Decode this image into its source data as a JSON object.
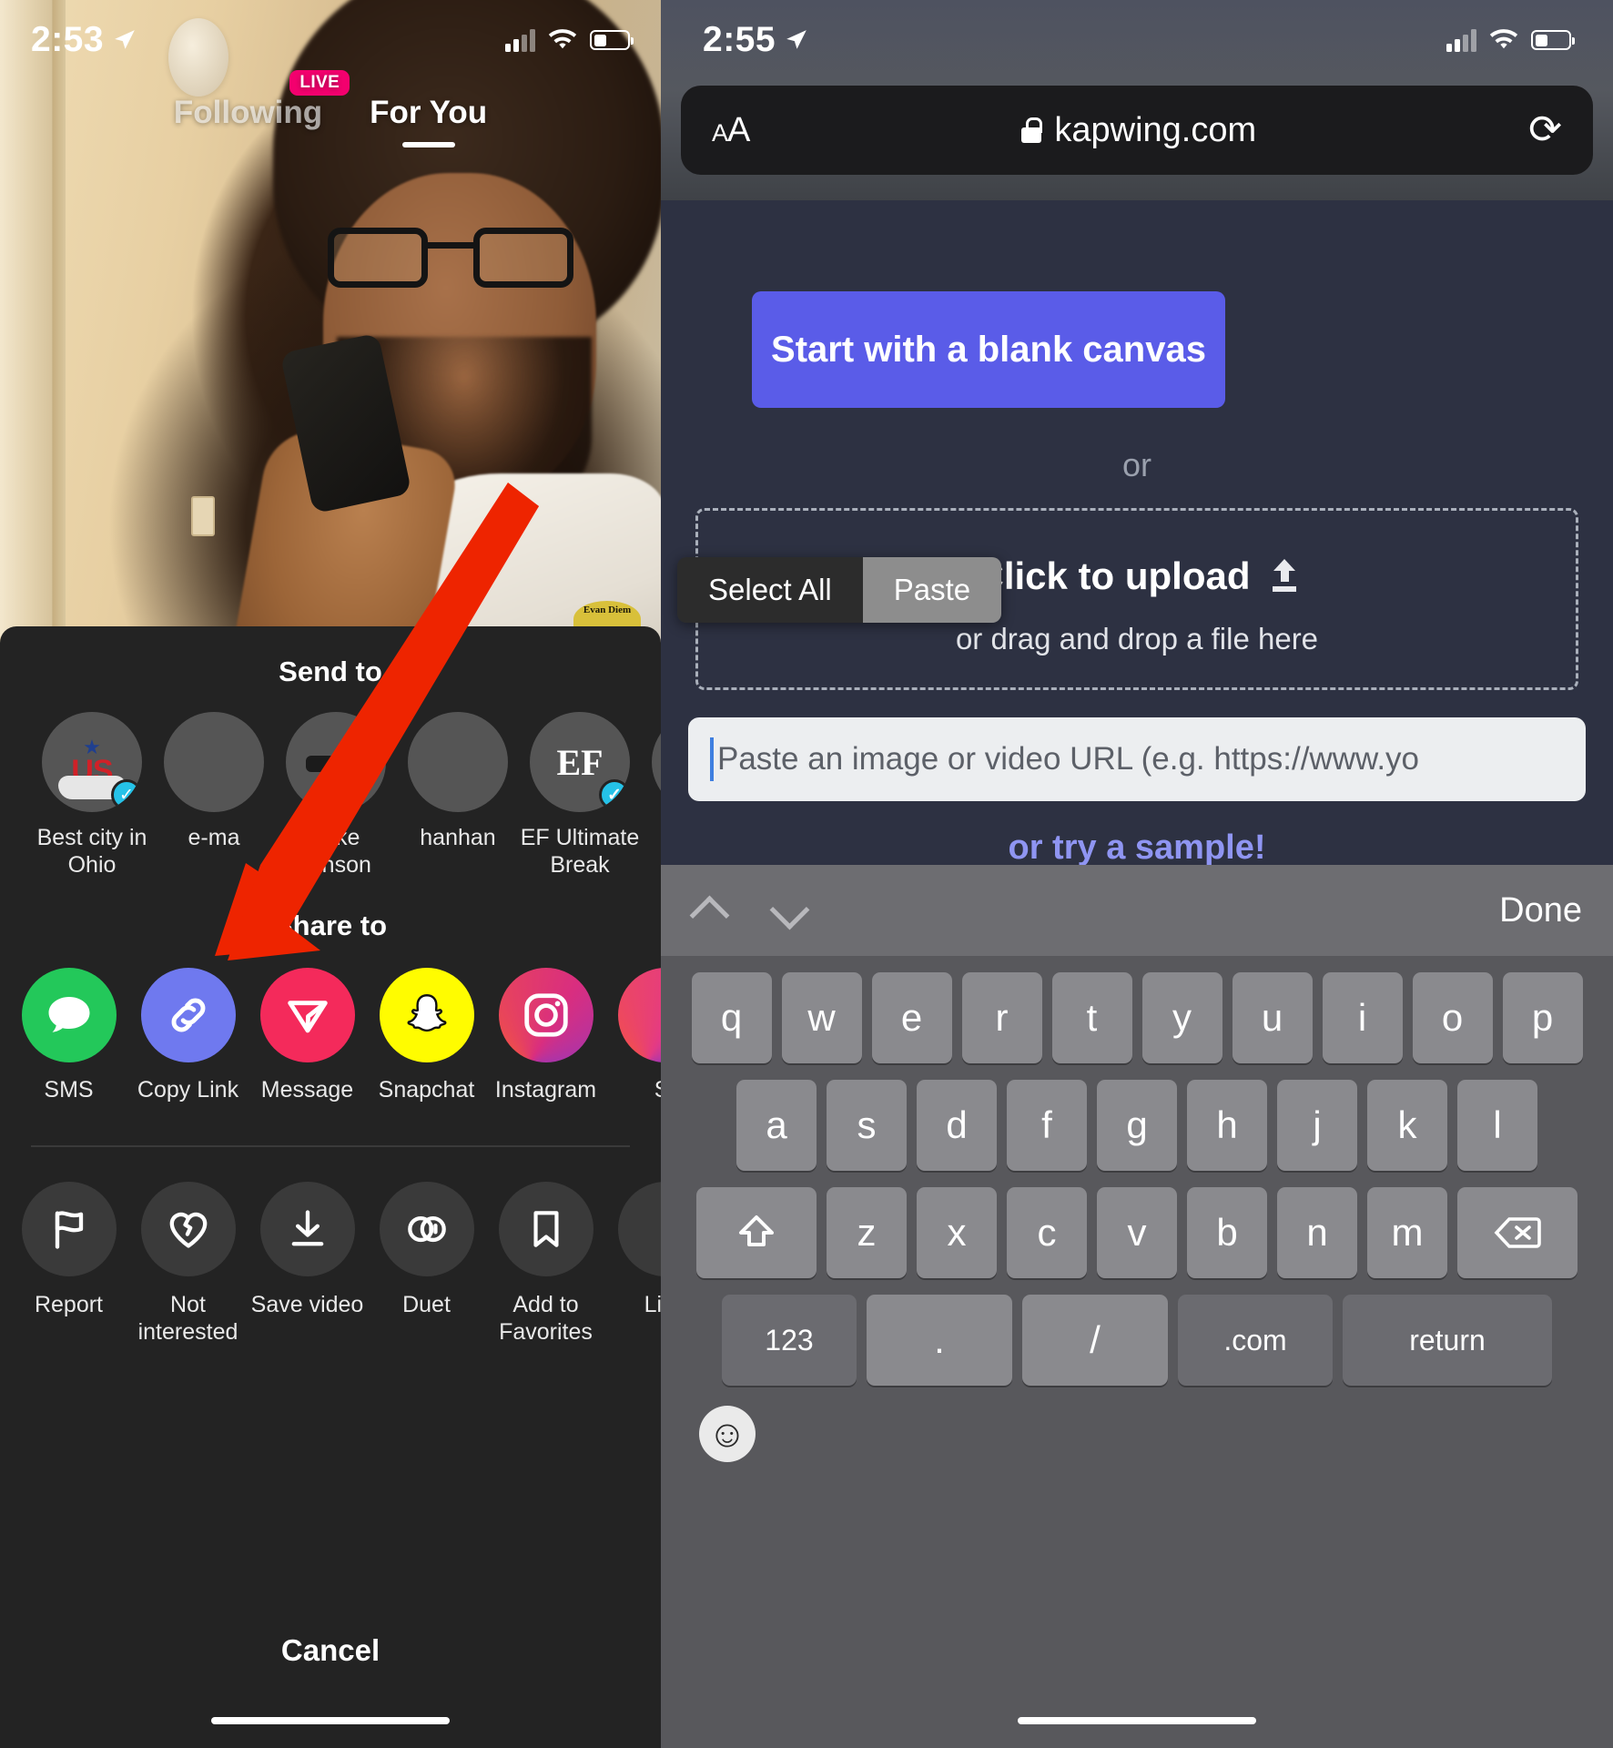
{
  "left_phone": {
    "status_bar": {
      "time": "2:53",
      "location_icon": "location-arrow-icon",
      "signal_icon": "cellular-bars-icon",
      "wifi_icon": "wifi-icon",
      "battery_icon": "battery-icon"
    },
    "tabs": [
      {
        "label": "Following",
        "active": false,
        "badge": "LIVE"
      },
      {
        "label": "For You",
        "active": true,
        "badge": null
      }
    ],
    "video_watermark": "Evan Diem",
    "share_sheet": {
      "send_to_title": "Send to",
      "contacts": [
        {
          "name": "Best city in Ohio",
          "verified": true
        },
        {
          "name": "e-ma",
          "verified": false
        },
        {
          "name": "Mike Hinson",
          "verified": false
        },
        {
          "name": "hanhan",
          "verified": false
        },
        {
          "name": "EF Ultimate Break",
          "verified": true
        },
        {
          "name": "",
          "verified": false
        }
      ],
      "share_to_title": "Share to",
      "apps": [
        {
          "label": "SMS",
          "icon": "sms-bubble-icon"
        },
        {
          "label": "Copy Link",
          "icon": "link-chain-icon"
        },
        {
          "label": "Message",
          "icon": "tiktok-message-send-icon"
        },
        {
          "label": "Snapchat",
          "icon": "snapchat-ghost-icon"
        },
        {
          "label": "Instagram",
          "icon": "instagram-camera-icon"
        },
        {
          "label": "St",
          "icon": "more-apps-icon"
        }
      ],
      "actions": [
        {
          "label": "Report",
          "icon": "flag-icon"
        },
        {
          "label": "Not interested",
          "icon": "broken-heart-icon"
        },
        {
          "label": "Save video",
          "icon": "download-icon"
        },
        {
          "label": "Duet",
          "icon": "duet-circles-icon"
        },
        {
          "label": "Add to Favorites",
          "icon": "bookmark-icon"
        },
        {
          "label": "Live",
          "icon": "live-photo-icon"
        }
      ],
      "cancel_label": "Cancel"
    },
    "annotation": {
      "arrow_color": "#ee2400",
      "arrow_target": "Copy Link"
    }
  },
  "right_phone": {
    "status_bar": {
      "time": "2:55",
      "location_icon": "location-arrow-icon"
    },
    "browser": {
      "text_size_label": "AA",
      "lock_icon": "lock-icon",
      "url": "kapwing.com",
      "reload_icon": "reload-icon"
    },
    "page": {
      "blank_canvas_button": "Start with a blank canvas",
      "or_label": "or",
      "upload_title": "Click to upload",
      "upload_icon": "upload-arrow-icon",
      "upload_subtitle": "or drag and drop a file here",
      "url_input_placeholder": "Paste an image or video URL (e.g. https://www.yo",
      "url_input_value": "",
      "try_sample_label": "or try a sample!"
    },
    "context_menu": {
      "items": [
        "Select All",
        "Paste"
      ],
      "selected": "Paste"
    },
    "keyboard": {
      "toolbar": {
        "prev_icon": "chevron-up-icon",
        "next_icon": "chevron-down-icon",
        "done_label": "Done"
      },
      "row1": [
        "q",
        "w",
        "e",
        "r",
        "t",
        "y",
        "u",
        "i",
        "o",
        "p"
      ],
      "row2": [
        "a",
        "s",
        "d",
        "f",
        "g",
        "h",
        "j",
        "k",
        "l"
      ],
      "row3": [
        "z",
        "x",
        "c",
        "v",
        "b",
        "n",
        "m"
      ],
      "shift_icon": "shift-arrow-icon",
      "backspace_icon": "backspace-icon",
      "numeric_label": "123",
      "period_label": ".",
      "slash_label": "/",
      "dotcom_label": ".com",
      "return_label": "return",
      "emoji_icon": "emoji-face-icon"
    }
  }
}
